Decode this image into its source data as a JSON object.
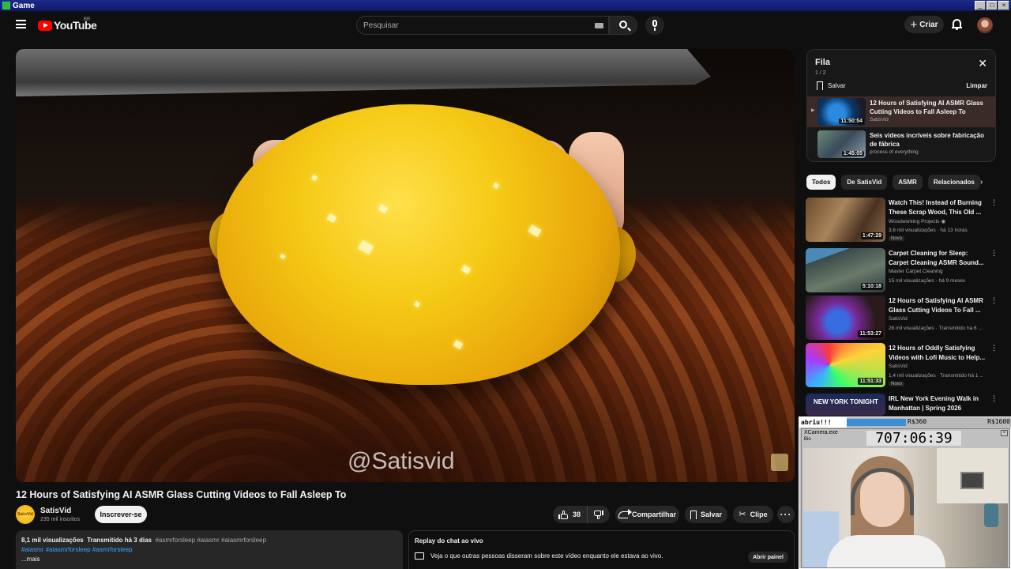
{
  "window": {
    "title": "Game",
    "buttons": [
      "_",
      "□",
      "×"
    ]
  },
  "topbar": {
    "logo_text": "YouTube",
    "region": "BR",
    "search_placeholder": "Pesquisar",
    "create_label": "Criar",
    "icons": [
      "menu-icon",
      "keyboard-icon",
      "search-icon",
      "mic-icon",
      "plus-icon",
      "bell-icon",
      "avatar"
    ]
  },
  "video": {
    "watermark": "@Satisvid",
    "title": "12 Hours of Satisfying AI ASMR Glass Cutting Videos to Fall Asleep To",
    "channel": {
      "name": "SatisVid",
      "subscribers": "235 mil inscritos",
      "avatar_text": "SatisVid"
    },
    "subscribe_label": "Inscrever-se",
    "actions": {
      "likes": "38",
      "share": "Compartilhar",
      "save": "Salvar",
      "clip": "Clipe",
      "more": "···"
    },
    "description": {
      "views": "8,1 mil visualizações",
      "streamed": "Transmitido há 3 dias",
      "hashtags_line1": "#asmrforsleep #aiasmr #aiasmrforsleep",
      "hashtags_line2": "#aiasmr #aiasmrforsleep #asmrforsleep",
      "more": "...mais"
    },
    "chat": {
      "title": "Replay do chat ao vivo",
      "text": "Veja o que outras pessoas disseram sobre este vídeo enquanto ele estava ao vivo.",
      "open_label": "Abrir painel"
    }
  },
  "queue": {
    "title": "Fila",
    "count": "1 / 2",
    "save_label": "Salvar",
    "clear_label": "Limpar",
    "items": [
      {
        "title": "12 Hours of Satisfying AI ASMR Glass Cutting Videos to Fall Asleep To",
        "channel": "SatisVid",
        "duration": "11:50:54",
        "marker": "▶"
      },
      {
        "title": "Seis vídeos incríveis sobre fabricação de fábrica",
        "channel": "process of everything",
        "duration": "1:45:05",
        "marker": ""
      }
    ]
  },
  "chips": [
    "Todos",
    "De SatisVid",
    "ASMR",
    "Relacionados"
  ],
  "recommendations": [
    {
      "title": "Watch This! Instead of Burning These Scrap Wood, This Old ...",
      "channel": "Woodworking Projects ◉",
      "meta": "3,6 mil visualizações · há 13 horas",
      "badge": "Novo",
      "duration": "1:47:29"
    },
    {
      "title": "Carpet Cleaning for Sleep: Carpet Cleaning ASMR Sound...",
      "channel": "Master Carpet Cleaning",
      "meta": "15 mil visualizações · há 9 meses",
      "badge": "",
      "duration": "5:10:18"
    },
    {
      "title": "12 Hours of Satisfying AI ASMR Glass Cutting Videos To Fall ...",
      "channel": "SatisVid",
      "meta": "28 mil visualizações · Transmitido há 6 ...",
      "badge": "",
      "duration": "11:53:27"
    },
    {
      "title": "12 Hours of Oddly Satisfying Videos with Lofi Music to Help...",
      "channel": "SatisVid",
      "meta": "1,4 mil visualizações · Transmitido há 1 ...",
      "badge": "Novo",
      "duration": "11:51:33"
    },
    {
      "title": "IRL New York Evening Walk in Manhattan | Spring 2026",
      "channel": "",
      "meta": "",
      "badge": "",
      "duration": "",
      "thumb_text": "NEW YORK TONIGHT"
    }
  ],
  "overlay": {
    "label": "abriu!!!",
    "value_mid": "R$360",
    "value_right": "R$1600",
    "progress": 0.28,
    "window_title": "XCamera.exe",
    "window_sub": "Bio",
    "timer": "707:06:39"
  },
  "colors": {
    "background": "#0f0f0f",
    "accent_red": "#ff0000",
    "link_blue": "#3ea6ff"
  }
}
